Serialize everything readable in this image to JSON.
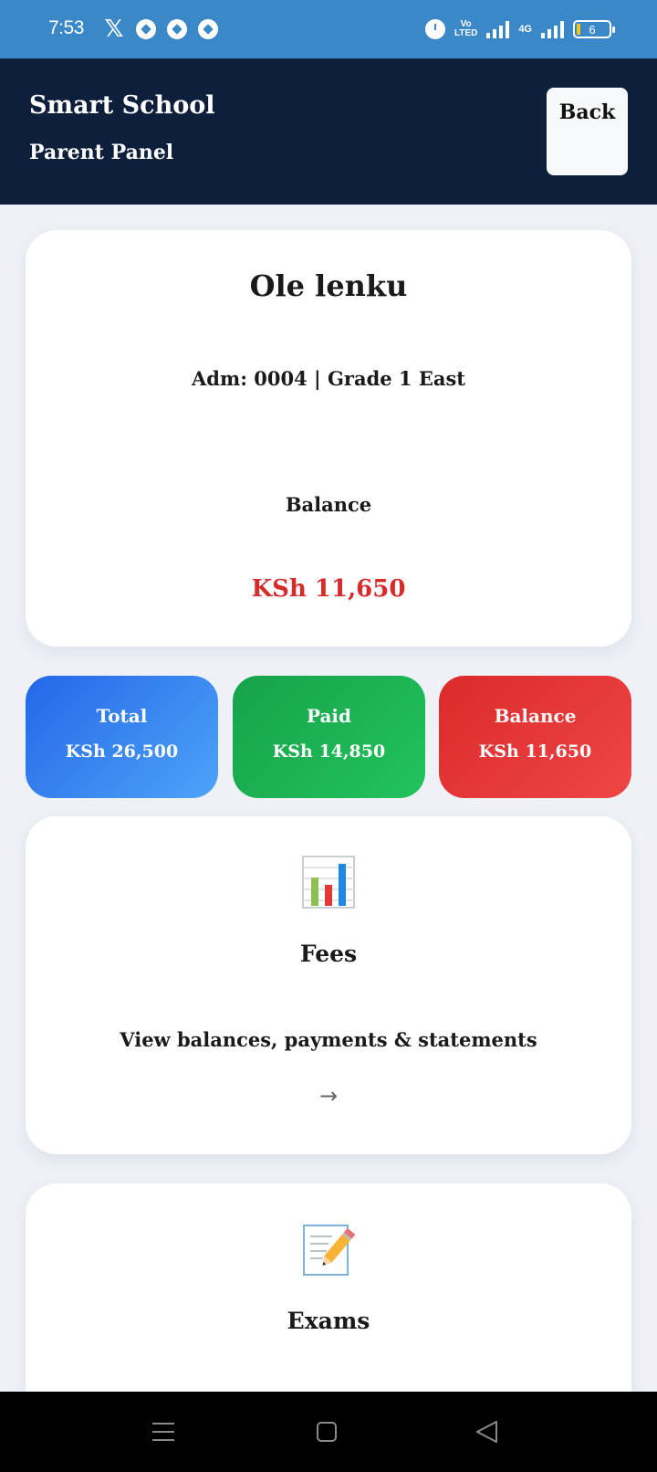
{
  "status_bar": {
    "time": "7:53",
    "icons": [
      "x-icon",
      "soccer-ball-icon",
      "soccer-ball-icon",
      "soccer-ball-icon",
      "alarm-icon",
      "volte-icon",
      "signal-icon",
      "4g-signal-icon",
      "battery-icon"
    ],
    "volte_top": "Vo",
    "volte_bottom": "LTED",
    "network": "4G",
    "battery_level": "6"
  },
  "header": {
    "title": "Smart School",
    "subtitle": "Parent Panel",
    "back_label": "Back",
    "background": "#0e1f3b"
  },
  "student": {
    "name": "Ole lenku",
    "meta": "Adm: 0004 | Grade 1 East",
    "balance_label": "Balance",
    "balance_value": "KSh 11,650",
    "balance_color": "#d62b2b"
  },
  "stats": [
    {
      "label": "Total",
      "value": "KSh 26,500",
      "color": "#2f7cf0"
    },
    {
      "label": "Paid",
      "value": "KSh 14,850",
      "color": "#1db352"
    },
    {
      "label": "Balance",
      "value": "KSh 11,650",
      "color": "#e53838"
    }
  ],
  "menu_cards": [
    {
      "icon": "bar-chart-icon",
      "title": "Fees",
      "description": "View balances, payments & statements",
      "arrow": "→"
    },
    {
      "icon": "memo-pencil-icon",
      "title": "Exams"
    }
  ],
  "nav_bar": {
    "icons": [
      "menu-icon",
      "home-square-icon",
      "back-triangle-icon"
    ]
  }
}
